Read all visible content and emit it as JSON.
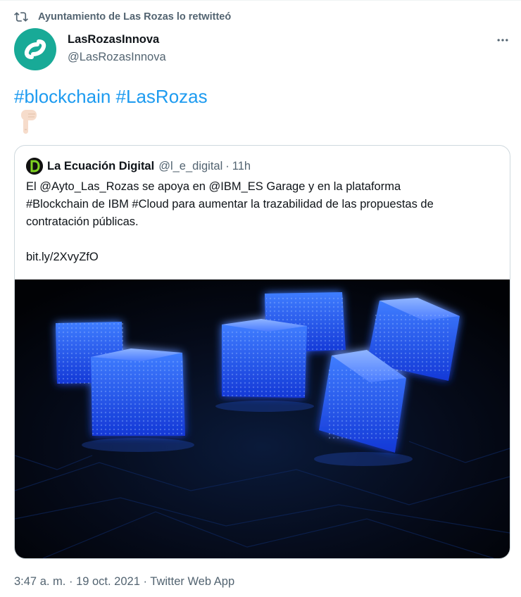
{
  "retweet": {
    "icon": "retweet-icon",
    "text": "Ayuntamiento de Las Rozas lo retwitteó"
  },
  "author": {
    "name": "LasRozasInnova",
    "handle": "@LasRozasInnova",
    "avatar_color": "#18aa97"
  },
  "tweet": {
    "hashtags": [
      "#blockchain",
      "#LasRozas"
    ],
    "emoji": "pointing-down-emoji",
    "link_color": "#1d9bf0"
  },
  "quote": {
    "name": "La Ecuación Digital",
    "handle": "@l_e_digital",
    "separator": "·",
    "time": "11h",
    "body_lines": [
      "El @Ayto_Las_Rozas se apoya en @IBM_ES Garage y en la plataforma",
      "#Blockchain de IBM #Cloud para aumentar la trazabilidad de las propuestas de",
      "contratación públicas."
    ],
    "link": "bit.ly/2XvyZfO",
    "image": "glowing-blue-blockchain-cubes-image"
  },
  "footer": {
    "time": "3:47 a. m.",
    "sep1": "·",
    "date": "19 oct. 2021",
    "sep2": "·",
    "source": "Twitter Web App"
  }
}
